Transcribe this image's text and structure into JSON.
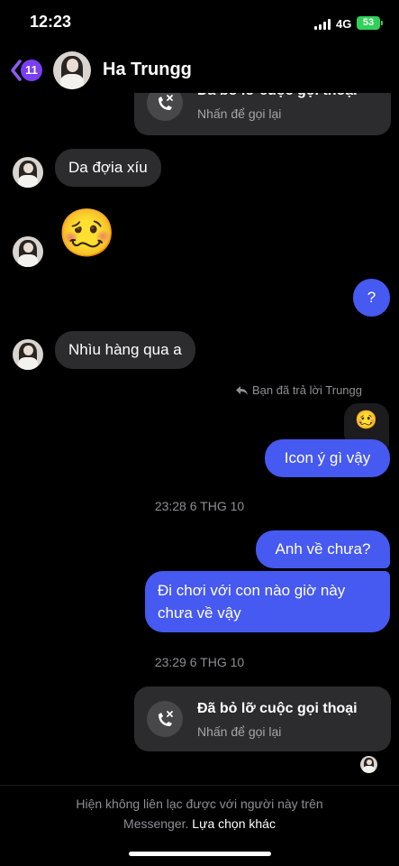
{
  "status": {
    "time": "12:23",
    "network": "4G",
    "battery": "53"
  },
  "header": {
    "unread_count": "11",
    "contact_name": "Ha Trungg"
  },
  "messages": {
    "call_top": {
      "title": "Đã bỏ lỡ cuộc gọi thoại",
      "subtitle": "Nhấn để gọi lại"
    },
    "in_1": "Da đợia xíu",
    "in_emoji": "🥴",
    "out_q": "?",
    "in_2": "Nhìu hàng qua a",
    "reply_note": "Bạn đã trả lời Trungg",
    "reply_quote_emoji": "🥴",
    "out_1": "Icon ý gì vậy",
    "timestamp_1": "23:28 6 THG 10",
    "out_2": "Anh về chưa?",
    "out_3": "Đi chơi với con nào giờ này chưa về vậy",
    "timestamp_2": "23:29 6 THG 10",
    "call_bottom": {
      "title": "Đã bỏ lỡ cuộc gọi thoại",
      "subtitle": "Nhấn để gọi lại"
    }
  },
  "footer": {
    "notice": "Hiện không liên lạc được với người này trên Messenger.",
    "link": "Lựa chọn khác"
  },
  "colors": {
    "outgoing": "#4659f0",
    "incoming": "#2c2c2e",
    "accent": "#7a3ff2"
  },
  "icons": [
    "back-chevron-icon",
    "missed-call-icon",
    "reply-arrow-icon",
    "signal-icon",
    "battery-icon"
  ]
}
